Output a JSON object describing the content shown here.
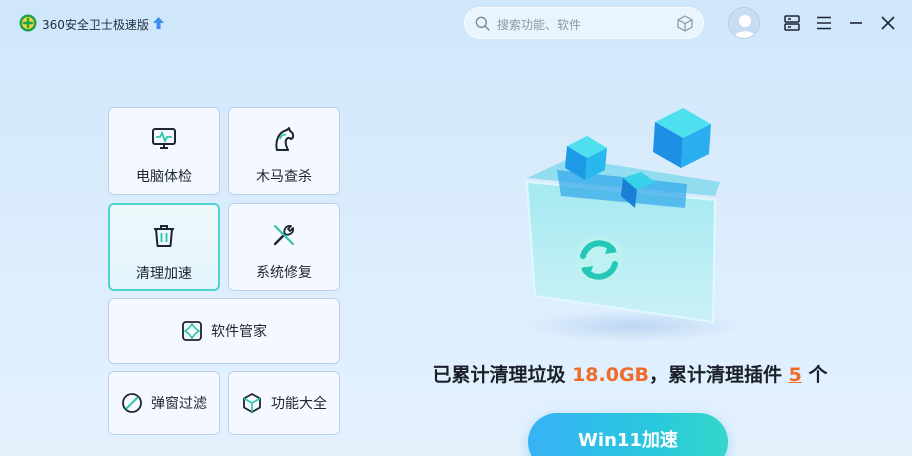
{
  "titlebar": {
    "app_title": "360安全卫士极速版",
    "search_placeholder": "搜索功能、软件"
  },
  "tiles": [
    {
      "label": "电脑体检",
      "icon": "monitor-pulse-icon"
    },
    {
      "label": "木马查杀",
      "icon": "horse-icon"
    },
    {
      "label": "清理加速",
      "icon": "trash-icon",
      "active": true
    },
    {
      "label": "系统修复",
      "icon": "tools-icon"
    },
    {
      "label": "软件管家",
      "icon": "software-manager-icon"
    },
    {
      "label": "弹窗过滤",
      "icon": "block-icon"
    },
    {
      "label": "功能大全",
      "icon": "box-icon"
    }
  ],
  "stats": {
    "prefix": "已累计清理垃圾 ",
    "junk_size": "18.0GB",
    "middle": "，累计清理插件 ",
    "plugin_count": "5",
    "suffix": " 个"
  },
  "cta_label": "Win11加速",
  "colors": {
    "accent": "#29c7de",
    "highlight": "#f06a2b",
    "active_border": "#4fd3cf"
  }
}
